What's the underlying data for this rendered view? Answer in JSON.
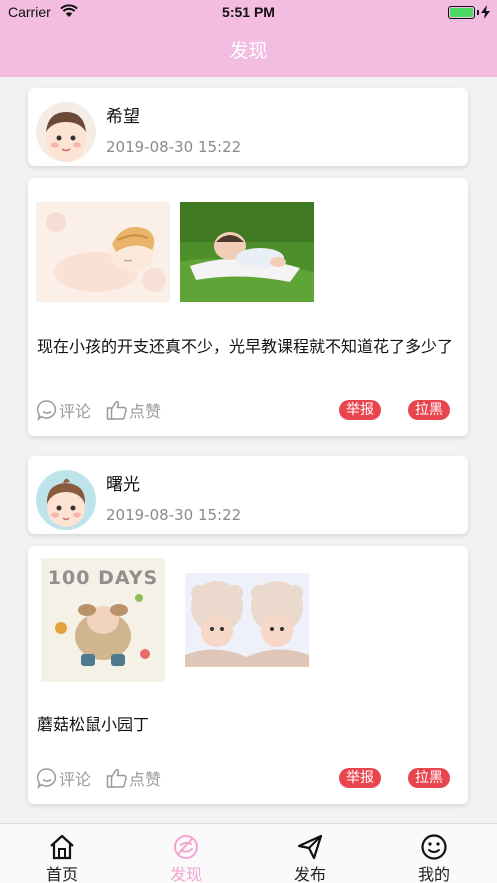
{
  "status_bar": {
    "carrier": "Carrier",
    "time": "5:51 PM",
    "battery_level": 1.0
  },
  "header": {
    "title": "发现"
  },
  "posts": [
    {
      "user": "希望",
      "time": "2019-08-30 15:22",
      "text": "现在小孩的开支还真不少，光早教课程就不知道花了多少了",
      "comment_label": "评论",
      "like_label": "点赞",
      "report_label": "举报",
      "block_label": "拉黑"
    },
    {
      "user": "曙光",
      "time": "2019-08-30 15:22",
      "text": "蘑菇松鼠小园丁",
      "photo_caption": "100 DAYS",
      "comment_label": "评论",
      "like_label": "点赞",
      "report_label": "举报",
      "block_label": "拉黑"
    }
  ],
  "tabs": [
    {
      "label": "首页",
      "icon": "home-icon"
    },
    {
      "label": "发现",
      "icon": "discover-icon",
      "active": true
    },
    {
      "label": "发布",
      "icon": "send-icon"
    },
    {
      "label": "我的",
      "icon": "profile-icon"
    }
  ],
  "colors": {
    "header": "#f2bde1",
    "active_tab": "#f2a4d2",
    "tag": "#e9454f"
  }
}
